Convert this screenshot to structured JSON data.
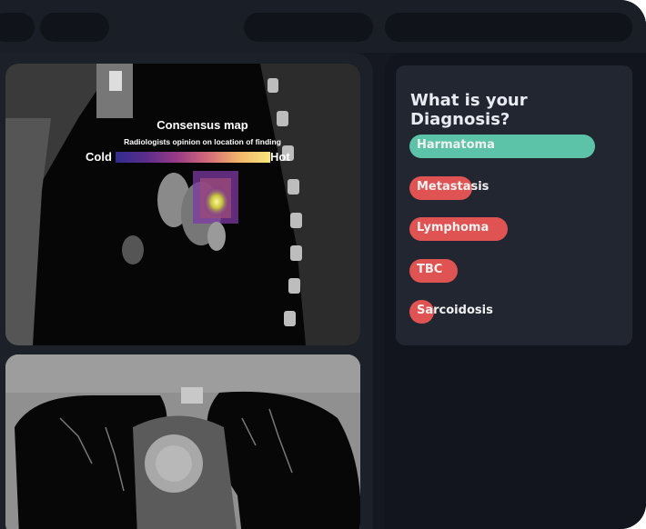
{
  "consensus_map": {
    "title": "Consensus map",
    "subtitle": "Radiologists opinion on location of finding",
    "cold_label": "Cold",
    "hot_label": "Hot"
  },
  "diagnosis": {
    "question": "What is your Diagnosis?",
    "options": [
      {
        "label": "Harmatoma",
        "share": 1.0,
        "color": "#5cc3a8"
      },
      {
        "label": "Metastasis",
        "share": 0.34,
        "color": "#df5353"
      },
      {
        "label": "Lymphoma",
        "share": 0.53,
        "color": "#df5353"
      },
      {
        "label": "TBC",
        "share": 0.26,
        "color": "#df5353"
      },
      {
        "label": "Sarcoidosis",
        "share": 0.13,
        "color": "#df5353"
      }
    ]
  }
}
